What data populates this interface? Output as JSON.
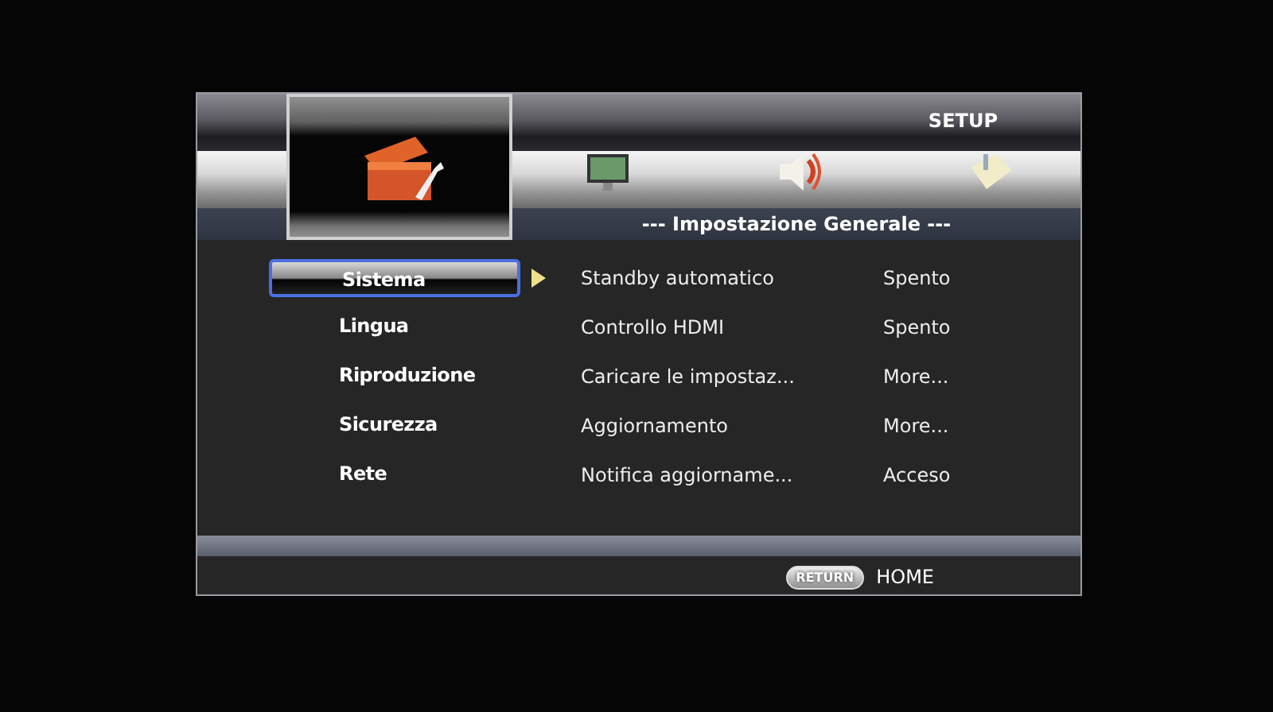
{
  "header": {
    "title": "SETUP",
    "subtitle": "--- Impostazione Generale ---"
  },
  "tabs": [
    {
      "kind": "toolbox",
      "selected": true
    },
    {
      "kind": "monitor",
      "selected": false
    },
    {
      "kind": "speaker",
      "selected": false
    },
    {
      "kind": "info",
      "selected": false
    }
  ],
  "categories": [
    {
      "label": "Sistema",
      "selected": true
    },
    {
      "label": "Lingua",
      "selected": false
    },
    {
      "label": "Riproduzione",
      "selected": false
    },
    {
      "label": "Sicurezza",
      "selected": false
    },
    {
      "label": "Rete",
      "selected": false
    }
  ],
  "settings": [
    {
      "name": "Standby automatico",
      "value": "Spento"
    },
    {
      "name": "Controllo HDMI",
      "value": "Spento"
    },
    {
      "name": "Caricare le impostaz...",
      "value": "More..."
    },
    {
      "name": "Aggiornamento",
      "value": "More..."
    },
    {
      "name": "Notifica aggiorname...",
      "value": "Acceso"
    }
  ],
  "footer": {
    "key": "RETURN",
    "label": "HOME"
  }
}
